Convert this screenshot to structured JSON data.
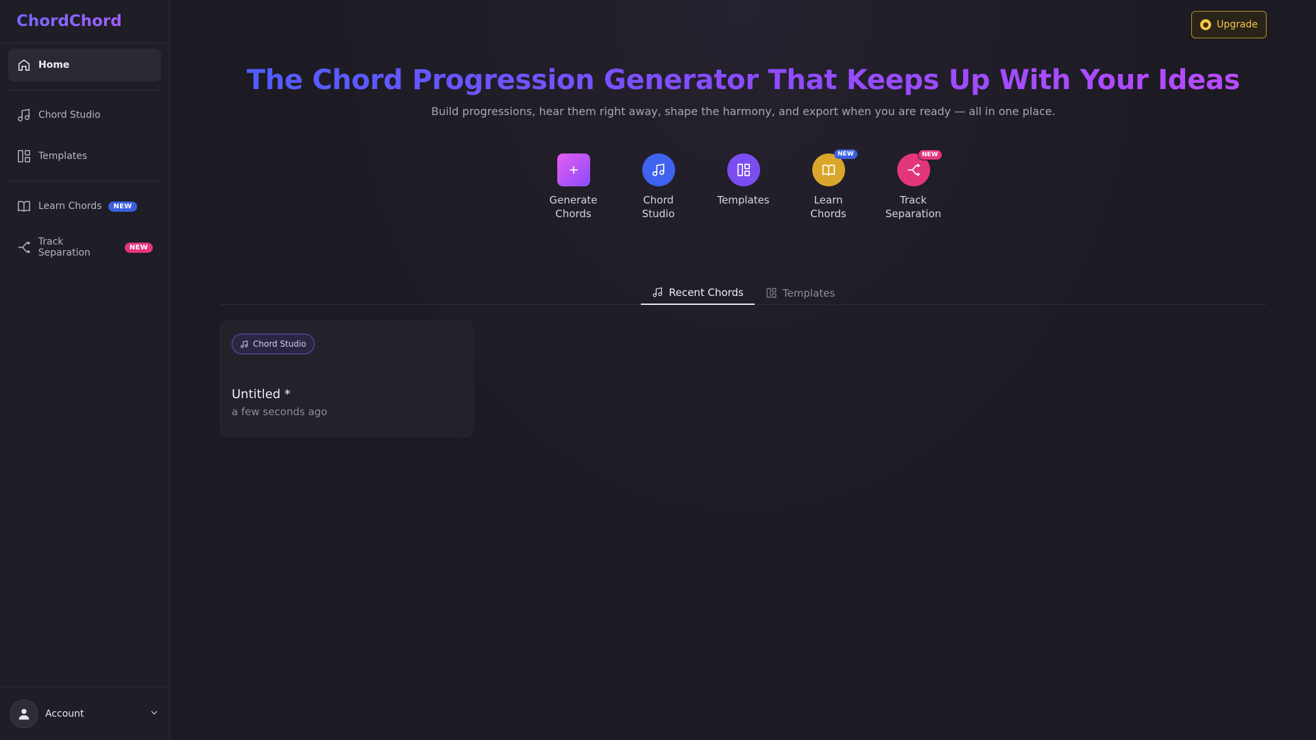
{
  "brand": "ChordChord",
  "sidebar": {
    "items": [
      {
        "label": "Home"
      },
      {
        "label": "Chord Studio"
      },
      {
        "label": "Templates"
      },
      {
        "label": "Learn Chords",
        "badge": "NEW"
      },
      {
        "label": "Track Separation",
        "badge": "NEW"
      }
    ],
    "account": "Account"
  },
  "header": {
    "upgrade": "Upgrade"
  },
  "hero": {
    "title": "The Chord Progression Generator That Keeps Up With Your Ideas",
    "subtitle": "Build progressions, hear them right away, shape the harmony, and export when you are ready — all in one place."
  },
  "quick_actions": [
    {
      "label": "Generate Chords",
      "color": "#c056f5"
    },
    {
      "label": "Chord Studio",
      "color": "#3f63ee"
    },
    {
      "label": "Templates",
      "color": "#7b4df0"
    },
    {
      "label": "Learn Chords",
      "badge": "NEW",
      "color": "#d8a62a"
    },
    {
      "label": "Track Separation",
      "badge": "NEW",
      "color": "#e3367a"
    }
  ],
  "tabs": [
    {
      "label": "Recent Chords",
      "active": true
    },
    {
      "label": "Templates",
      "active": false
    }
  ],
  "recent": [
    {
      "chip": "Chord Studio",
      "title": "Untitled *",
      "time": "a few seconds ago"
    }
  ]
}
